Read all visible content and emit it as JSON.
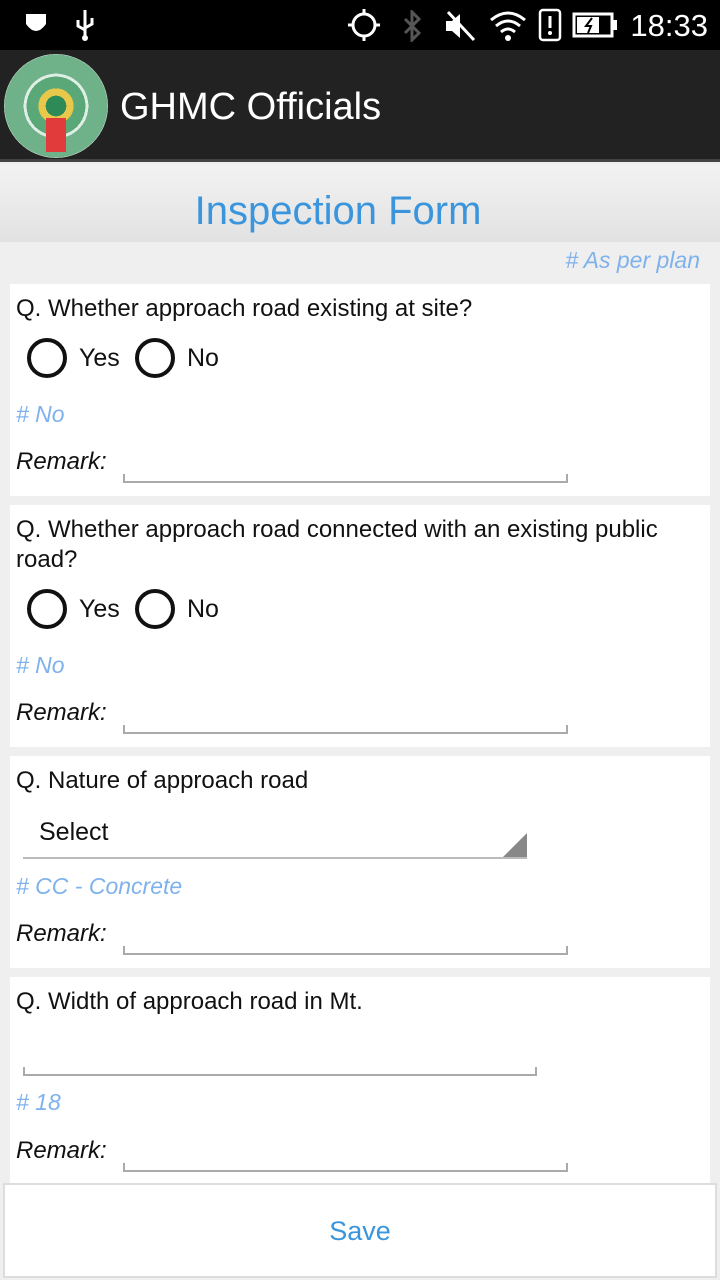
{
  "status_bar": {
    "time": "18:33",
    "icons": [
      "shield-icon",
      "usb-icon",
      "gps-icon",
      "bluetooth-icon",
      "mute-icon",
      "wifi-icon",
      "alert-icon",
      "battery-charging-icon"
    ]
  },
  "app_bar": {
    "title": "GHMC Officials"
  },
  "form": {
    "title": "Inspection Form",
    "top_hint": "# As per plan",
    "questions": [
      {
        "text": "Q. Whether approach road existing at site?",
        "options": [
          "Yes",
          "No"
        ],
        "hint": "# No",
        "remark_label": "Remark:"
      },
      {
        "text": "Q. Whether approach road connected with an existing public road?",
        "text_line1": "Q. Whether approach road connected with an existing public",
        "text_line2": "road?",
        "options": [
          "Yes",
          "No"
        ],
        "hint": "# No",
        "remark_label": "Remark:"
      },
      {
        "text": "Q. Nature of approach road",
        "select_value": "Select",
        "hint": "# CC - Concrete",
        "remark_label": "Remark:"
      },
      {
        "text": "Q. Width of approach road in Mt.",
        "input_value": "",
        "hint": "# 18",
        "remark_label": "Remark:"
      }
    ]
  },
  "save_label": "Save",
  "colors": {
    "accent": "#3a95dc",
    "hint": "#7fb2ec",
    "app_bar": "#222222"
  }
}
